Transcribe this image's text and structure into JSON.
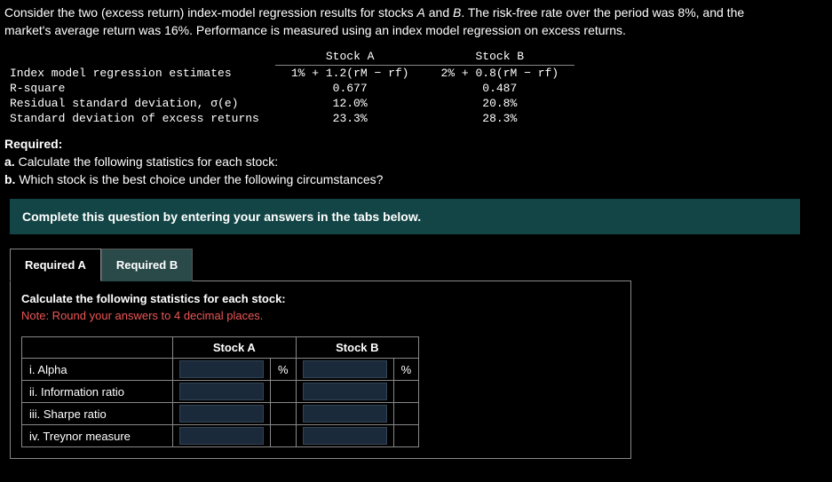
{
  "intro": {
    "line1a": "Consider the two (excess return) index-model regression results for stocks ",
    "stockA": "A",
    "mid": " and ",
    "stockB": "B",
    "line1b": ". The risk-free rate over the period was 8%, and the",
    "line2": "market's average return was 16%. Performance is measured using an index model regression on excess returns."
  },
  "data_table": {
    "colA": "Stock A",
    "colB": "Stock B",
    "rows": [
      {
        "label": "Index model regression estimates",
        "a": "1% + 1.2(rM − rf)",
        "b": "2% + 0.8(rM − rf)"
      },
      {
        "label": "R-square",
        "a": "0.677",
        "b": "0.487"
      },
      {
        "label": "Residual standard deviation, σ(e)",
        "a": "12.0%",
        "b": "20.8%"
      },
      {
        "label": "Standard deviation of excess returns",
        "a": "23.3%",
        "b": "28.3%"
      }
    ]
  },
  "required": {
    "heading": "Required:",
    "a_label": "a.",
    "a_text": " Calculate the following statistics for each stock:",
    "b_label": "b.",
    "b_text": " Which stock is the best choice under the following circumstances?"
  },
  "instruction": "Complete this question by entering your answers in the tabs below.",
  "tabs": {
    "a": "Required A",
    "b": "Required B"
  },
  "tab_content": {
    "title": "Calculate the following statistics for each stock:",
    "note": "Note: Round your answers to 4 decimal places."
  },
  "answer_table": {
    "colA": "Stock A",
    "colB": "Stock B",
    "rows": [
      {
        "label": "i. Alpha",
        "unit": "%"
      },
      {
        "label": "ii. Information ratio",
        "unit": ""
      },
      {
        "label": "iii. Sharpe ratio",
        "unit": ""
      },
      {
        "label": "iv. Treynor measure",
        "unit": ""
      }
    ]
  }
}
